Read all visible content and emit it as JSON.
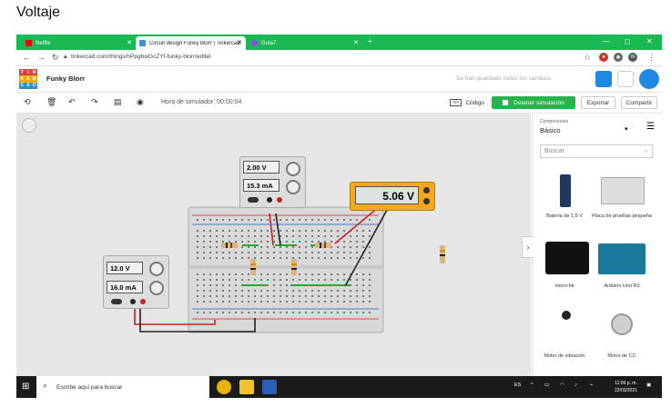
{
  "heading": "Voltaje",
  "browser": {
    "tabs": [
      {
        "label": "Netflix",
        "favicon_color": "#e50914",
        "active": false
      },
      {
        "label": "Circuit design Funky Blorr | Tinkercad",
        "favicon_color": "#3b8ee0",
        "active": true
      },
      {
        "label": "Guía7",
        "favicon_color": "#8c4de0",
        "active": false
      }
    ],
    "url": "tinkercad.com/things/hPpgbwGcZYf-funky-blorr/editel",
    "profile_initial": "m"
  },
  "app": {
    "logo_letters": [
      "T",
      "I",
      "N",
      "K",
      "E",
      "R",
      "C",
      "A",
      "D"
    ],
    "project_name": "Funky Blorr",
    "saved_text": "Se han guardado todos los cambios."
  },
  "toolbar": {
    "sim_time": "Hora de simulador: 00:00:04",
    "code_label": "Código",
    "stop_label": "Detener simulación",
    "export_label": "Exportar",
    "share_label": "Compartir"
  },
  "circuit": {
    "supply1": {
      "voltage": "2.00 V",
      "current": "15.3 mA"
    },
    "supply2": {
      "voltage": "12.0 V",
      "current": "16.0 mA"
    },
    "multimeter": {
      "reading": "5.06 V"
    }
  },
  "panel": {
    "category_small": "Componentes",
    "category": "Básico",
    "search_placeholder": "Buscar",
    "components": [
      {
        "label": "Batería de 1,5 V"
      },
      {
        "label": "Placa de pruebas pequeña"
      },
      {
        "label": "micro:bit"
      },
      {
        "label": "Arduino Uno R3"
      },
      {
        "label": "Motor de vibración"
      },
      {
        "label": "Motor de CC"
      }
    ]
  },
  "taskbar": {
    "search_text": "Escribe aquí para buscar",
    "lang": "ES",
    "time": "11:09 p. m.",
    "date": "22/03/2021"
  },
  "colors": {
    "tab_green": "#1bb954",
    "stop_button": "#2bb24c",
    "multimeter_body": "#f3a91c"
  }
}
